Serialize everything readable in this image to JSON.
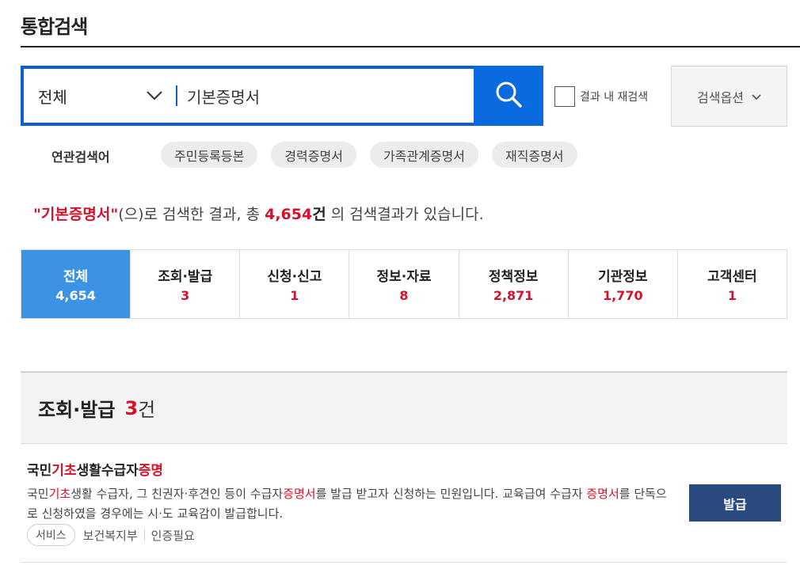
{
  "page_title": "통합검색",
  "search": {
    "scope_label": "전체",
    "query": "기본증명서",
    "within_label": "결과 내 재검색",
    "options_label": "검색옵션"
  },
  "related": {
    "label": "연관검색어",
    "chips": [
      "주민등록등본",
      "경력증명서",
      "가족관계증명서",
      "재직증명서"
    ]
  },
  "result_summary": {
    "open_quote": "\"",
    "keyword": "기본증명서",
    "close_quote": "\"",
    "text_before_count": "(으)로 검색한 결과, 총 ",
    "count": "4,654",
    "unit": "건",
    "text_after": " 의 검색결과가 있습니다."
  },
  "tabs": [
    {
      "label": "전체",
      "count": "4,654"
    },
    {
      "label": "조회·발급",
      "count": "3"
    },
    {
      "label": "신청·신고",
      "count": "1"
    },
    {
      "label": "정보·자료",
      "count": "8"
    },
    {
      "label": "정책정보",
      "count": "2,871"
    },
    {
      "label": "기관정보",
      "count": "1,770"
    },
    {
      "label": "고객센터",
      "count": "1"
    }
  ],
  "section": {
    "title": "조회·발급",
    "count": "3",
    "unit": "건"
  },
  "result_item": {
    "title_parts": [
      "국민",
      "기초",
      "생활수급자",
      "증명"
    ],
    "desc_parts": [
      "국민",
      "기초",
      "생활 수급자, 그 친권자·후견인 등이 수급자",
      "증명서",
      "를 발급 받고자 신청하는 민원입니다. 교육급여 수급자 ",
      "증명서",
      "를 단독으로 신청하였을 경우에는 시·도 교육감이 발급합니다."
    ],
    "badge": "서비스",
    "org": "보건복지부",
    "auth": "인증필요",
    "button": "발급"
  },
  "colors": {
    "accent_blue": "#0a5fd6",
    "tab_active": "#3c93e6",
    "highlight_red": "#d4122b",
    "issue_button": "#2a4a7f"
  }
}
